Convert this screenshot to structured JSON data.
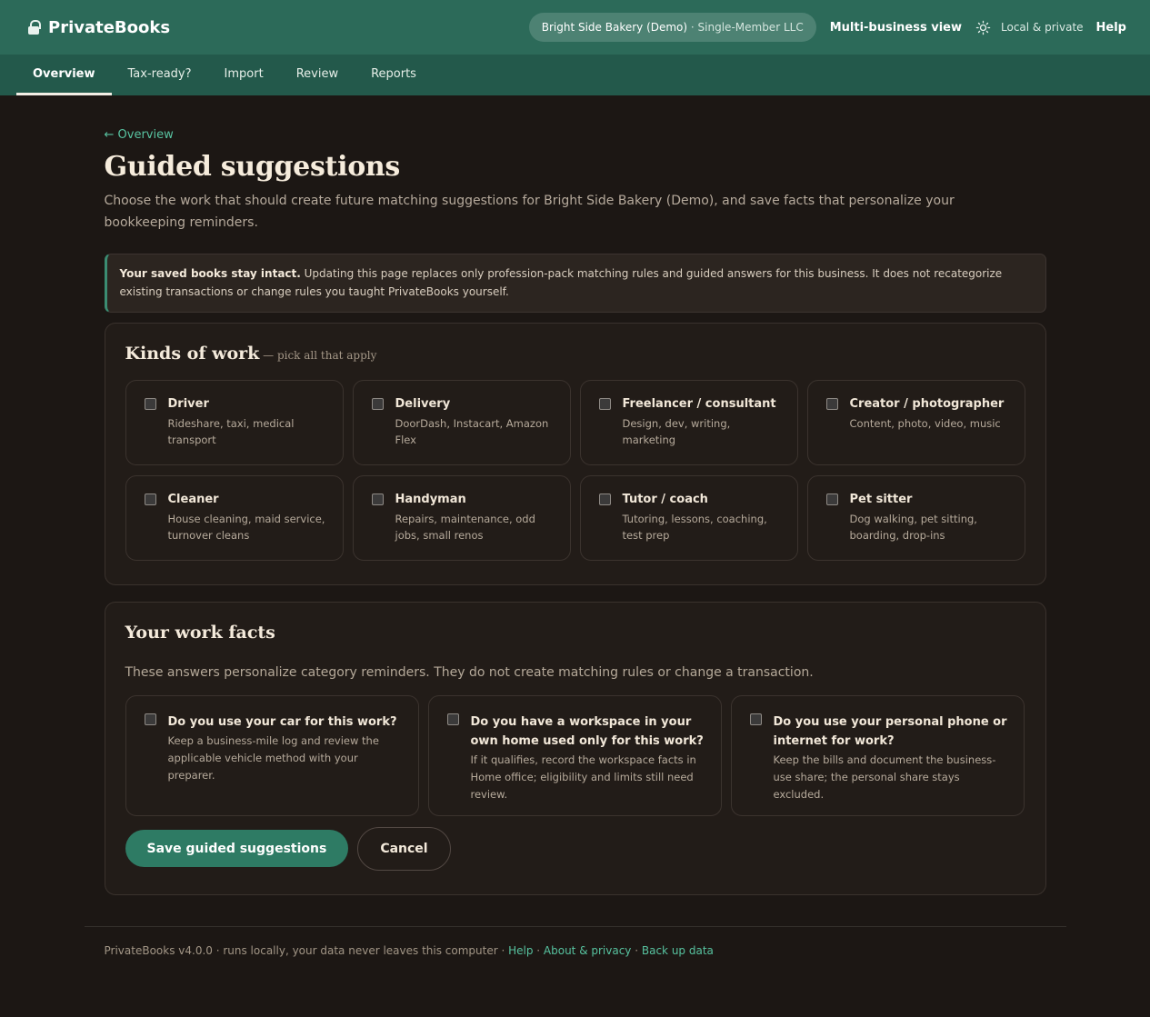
{
  "app": {
    "name": "PrivateBooks"
  },
  "header": {
    "business_name": "Bright Side Bakery (Demo)",
    "business_type": "Single-Member LLC",
    "multi_business": "Multi-business view",
    "local_private": "Local & private",
    "help": "Help",
    "theme_icon": "sun-icon",
    "lock_icon": "lock-icon"
  },
  "nav": {
    "tabs": [
      {
        "label": "Overview",
        "active": true
      },
      {
        "label": "Tax-ready?"
      },
      {
        "label": "Import"
      },
      {
        "label": "Review"
      },
      {
        "label": "Reports"
      }
    ]
  },
  "page": {
    "back_link": "← Overview",
    "title": "Guided suggestions",
    "intro": "Choose the work that should create future matching suggestions for Bright Side Bakery (Demo), and save facts that personalize your bookkeeping reminders."
  },
  "notice": {
    "lead": "Your saved books stay intact.",
    "body": " Updating this page replaces only profession-pack matching rules and guided answers for this business. It does not recategorize existing transactions or change rules you taught PrivateBooks yourself."
  },
  "work": {
    "title": "Kinds of work",
    "hint": " — pick all that apply",
    "options": [
      {
        "label": "Driver",
        "desc": "Rideshare, taxi, medical transport"
      },
      {
        "label": "Delivery",
        "desc": "DoorDash, Instacart, Amazon Flex"
      },
      {
        "label": "Freelancer / consultant",
        "desc": "Design, dev, writing, marketing"
      },
      {
        "label": "Creator / photographer",
        "desc": "Content, photo, video, music"
      },
      {
        "label": "Cleaner",
        "desc": "House cleaning, maid service, turnover cleans"
      },
      {
        "label": "Handyman",
        "desc": "Repairs, maintenance, odd jobs, small renos"
      },
      {
        "label": "Tutor / coach",
        "desc": "Tutoring, lessons, coaching, test prep"
      },
      {
        "label": "Pet sitter",
        "desc": "Dog walking, pet sitting, boarding, drop-ins"
      }
    ]
  },
  "facts": {
    "title": "Your work facts",
    "intro": "These answers personalize category reminders. They do not create matching rules or change a transaction.",
    "items": [
      {
        "label": "Do you use your car for this work?",
        "desc": "Keep a business-mile log and review the applicable vehicle method with your preparer."
      },
      {
        "label": "Do you have a workspace in your own home used only for this work?",
        "desc": "If it qualifies, record the workspace facts in Home office; eligibility and limits still need review."
      },
      {
        "label": "Do you use your personal phone or internet for work?",
        "desc": "Keep the bills and document the business-use share; the personal share stays excluded."
      }
    ]
  },
  "actions": {
    "save": "Save guided suggestions",
    "cancel": "Cancel"
  },
  "footer": {
    "text": "PrivateBooks v4.0.0 · runs locally, your data never leaves this computer · ",
    "help": "Help",
    "sep": " · ",
    "about": "About & privacy",
    "backup": "Back up data"
  }
}
